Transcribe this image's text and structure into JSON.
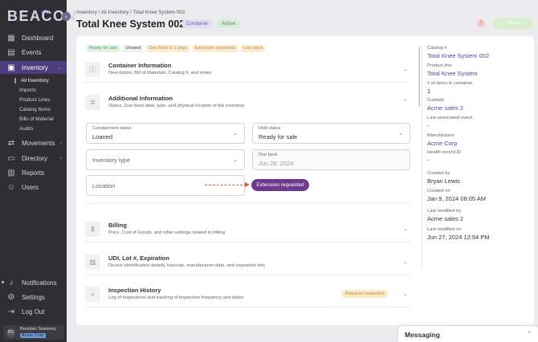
{
  "app": {
    "logo_text": "BEACON",
    "collapse_icon": "chevron-left-icon"
  },
  "sidebar": {
    "items": [
      {
        "label": "Dashboard",
        "icon": "grid-icon"
      },
      {
        "label": "Events",
        "icon": "calendar-icon"
      },
      {
        "label": "Inventory",
        "icon": "briefcase-icon"
      },
      {
        "label": "Movements",
        "icon": "arrows-icon"
      },
      {
        "label": "Directory",
        "icon": "folder-icon"
      },
      {
        "label": "Reports",
        "icon": "chart-icon"
      },
      {
        "label": "Users",
        "icon": "users-icon"
      }
    ],
    "inventory_sub": [
      "All Inventory",
      "Imports",
      "Product Lines",
      "Catalog Items",
      "Bills of Material",
      "Audits"
    ],
    "bottom": [
      {
        "label": "Notifications",
        "icon": "bell-icon"
      },
      {
        "label": "Settings",
        "icon": "gear-icon"
      },
      {
        "label": "Log Out",
        "icon": "logout-icon"
      }
    ],
    "user": {
      "initials": "BS",
      "name": "Brendan Sweeney",
      "org": "Acme Corp"
    }
  },
  "header": {
    "breadcrumb": "Inventory  /  All Inventory  /  Total Knee System 002",
    "title": "Total Knee System 002",
    "badge_type": "Container",
    "badge_status": "Active",
    "save_label": "Save"
  },
  "tags": [
    "Ready for sale",
    "Unused",
    "Due Back in 1 days",
    "Extension requested",
    "Low stock"
  ],
  "sections": {
    "container": {
      "title": "Container Information",
      "desc": "Description, Bill of Materials, Catalog #, and notes"
    },
    "additional": {
      "title": "Additional Information",
      "desc": "Status, Due back date, type, and physical location of the inventory"
    },
    "billing": {
      "title": "Billing",
      "desc": "Price, Cost of Goods, and other settings related to billing"
    },
    "udi": {
      "title": "UDI, Lot #, Expiration",
      "desc": "Device identification details, barcode, manufacturer data, and expiration info"
    },
    "inspection": {
      "title": "Inspection History",
      "desc": "Log of inspections and tracking of inspection frequency and dates",
      "badge": "Requires inspection"
    }
  },
  "form": {
    "consignment_label": "Consignment status",
    "consignment_value": "Loaned",
    "hold_label": "Hold status",
    "hold_value": "Ready for sale",
    "inventory_type_placeholder": "Inventory type",
    "due_back_label": "Due back",
    "due_back_value": "Jun 28, 2024",
    "location_placeholder": "Location",
    "extension_button": "Extension requested"
  },
  "details": {
    "catalog_label": "Catalog #",
    "catalog_value": "Total Knee System 002",
    "product_line_label": "Product line",
    "product_line_value": "Total Knee System",
    "items_label": "# of items in container",
    "items_value": "1",
    "custody_label": "Custody",
    "custody_value": "Acme sales 2",
    "last_event_label": "Last associated event",
    "last_event_value": "-",
    "manufacturer_label": "Manufacturer",
    "manufacturer_value": "Acme Corp",
    "health_label": "Health record ID",
    "health_value": "-",
    "created_by_label": "Created by",
    "created_by_value": "Bryan Lewis",
    "created_on_label": "Created on",
    "created_on_value": "Jan 9, 2024 08:05 AM",
    "modified_by_label": "Last modified by",
    "modified_by_value": "Acme sales 2",
    "modified_on_label": "Last modified on",
    "modified_on_value": "Jun 27, 2024 12:54 PM"
  },
  "messaging": {
    "title": "Messaging"
  },
  "colors": {
    "accent": "#4b3d7e",
    "link": "#5d3f9e",
    "sidebar_bg": "#2e2e33",
    "extension_button": "#6d3a8e",
    "arrow": "#d85a3a"
  }
}
